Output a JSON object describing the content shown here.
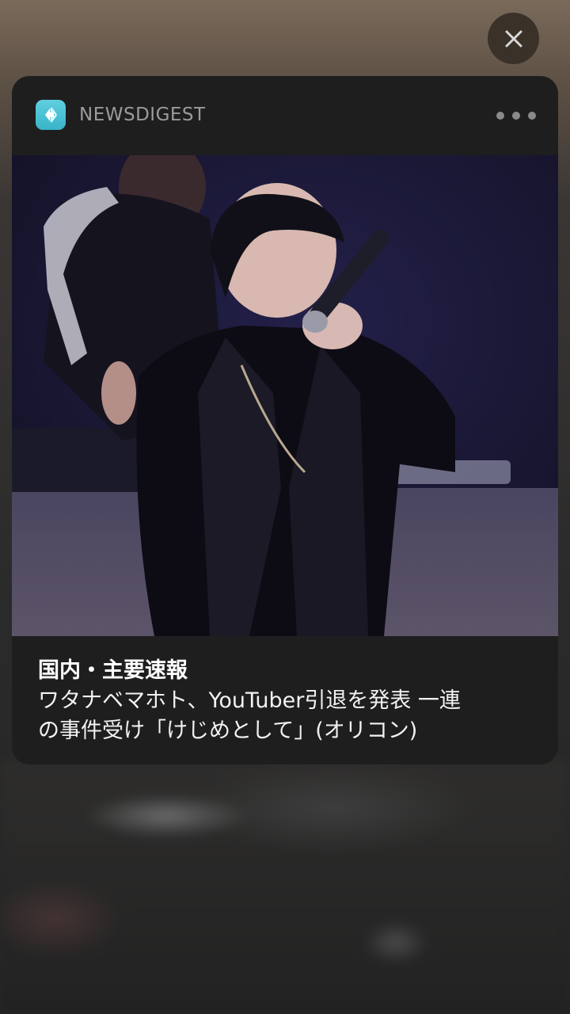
{
  "notification": {
    "app_name": "NEWSDIGEST",
    "icon": "newsdigest-app-icon",
    "category": "国内・主要速報",
    "body_line1": "ワタナベマホト、YouTuber引退を発表 一連",
    "body_line2": "の事件受け「けじめとして」(オリコン)",
    "image": "performer-with-microphone-photo"
  },
  "controls": {
    "close_icon": "close-icon",
    "more_icon": "more-options-icon"
  },
  "colors": {
    "card_bg": "#1e1e1f",
    "app_icon_accent": "#4cc3d6",
    "close_bg": "#3a3129"
  }
}
